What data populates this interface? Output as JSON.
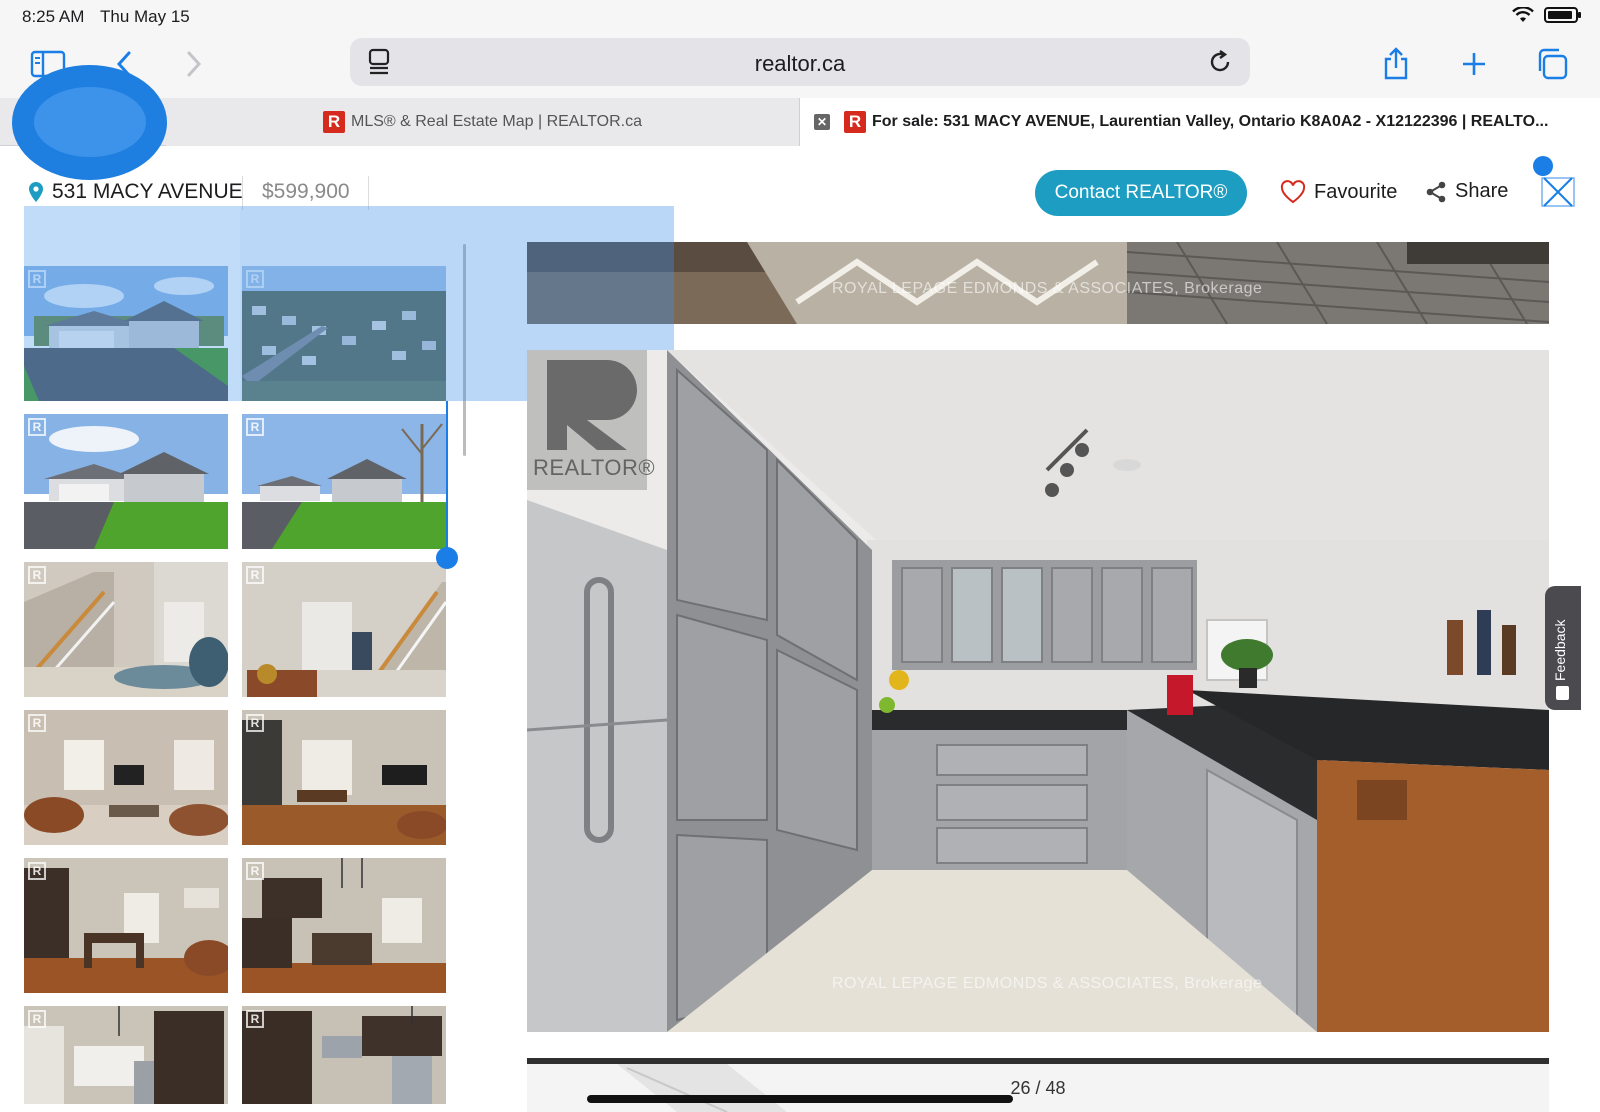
{
  "status_bar": {
    "time": "8:25 AM",
    "date": "Thu May 15"
  },
  "browser": {
    "url": "realtor.ca",
    "tabs": [
      {
        "label": "MLS® & Real Estate Map | REALTOR.ca",
        "logo": "R"
      },
      {
        "label": "For sale: 531 MACY AVENUE, Laurentian Valley, Ontario K8A0A2 - X12122396 | REALTO...",
        "logo": "R",
        "close": "✕"
      }
    ]
  },
  "listing": {
    "address": "531 MACY AVENUE",
    "price": "$599,900",
    "contact_label": "Contact REALTOR®",
    "favourite_label": "Favourite",
    "share_label": "Share"
  },
  "gallery": {
    "watermark": "ROYAL LEPAGE EDMONDS & ASSOCIATES, Brokerage",
    "main_logo_text": "REALTOR®",
    "counter": "26 / 48",
    "thumb_logo": "R"
  },
  "feedback_label": "Feedback",
  "colors": {
    "accent": "#1c9dc1",
    "brand_red": "#d52b1e",
    "selection": "#3f91ea"
  }
}
